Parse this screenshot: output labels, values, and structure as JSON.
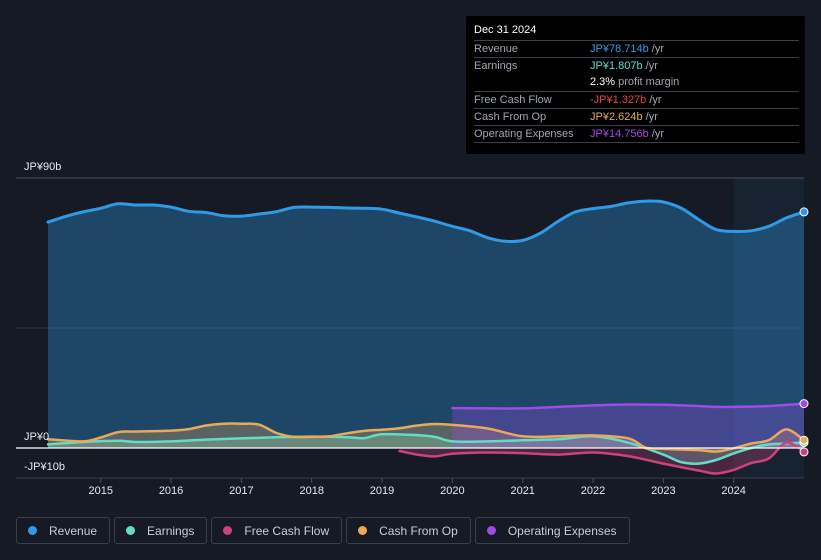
{
  "tooltip": {
    "date": "Dec 31 2024",
    "rows": [
      {
        "label": "Revenue",
        "value": "JP¥78.714b",
        "unit": " /yr",
        "color": "#2f9be6"
      },
      {
        "label": "Earnings",
        "value": "JP¥1.807b",
        "unit": " /yr",
        "color": "#62dcc6"
      },
      {
        "label": "",
        "value": "2.3%",
        "unit": " profit margin",
        "color": "#ffffff"
      },
      {
        "label": "Free Cash Flow",
        "value": "-JP¥1.327b",
        "unit": " /yr",
        "color": "#e8414a"
      },
      {
        "label": "Cash From Op",
        "value": "JP¥2.624b",
        "unit": " /yr",
        "color": "#e8a95a"
      },
      {
        "label": "Operating Expenses",
        "value": "JP¥14.756b",
        "unit": " /yr",
        "color": "#a04ae8"
      }
    ]
  },
  "legend": [
    {
      "label": "Revenue",
      "color": "#2f9be6"
    },
    {
      "label": "Earnings",
      "color": "#62dcc6"
    },
    {
      "label": "Free Cash Flow",
      "color": "#c9447f"
    },
    {
      "label": "Cash From Op",
      "color": "#e8a95a"
    },
    {
      "label": "Operating Expenses",
      "color": "#a04ae8"
    }
  ],
  "chart_data": {
    "type": "area",
    "title": "",
    "xlabel": "",
    "ylabel": "",
    "y_tick_labels": [
      {
        "value": 90,
        "label": "JP¥90b"
      },
      {
        "value": 0,
        "label": "JP¥0"
      },
      {
        "value": -10,
        "label": "-JP¥10b"
      }
    ],
    "ylim": [
      -10,
      90
    ],
    "xlim": [
      2014.25,
      2025.0
    ],
    "x_ticks": [
      2015,
      2016,
      2017,
      2018,
      2019,
      2020,
      2021,
      2022,
      2023,
      2024
    ],
    "x_tick_labels": [
      "2015",
      "2016",
      "2017",
      "2018",
      "2019",
      "2020",
      "2021",
      "2022",
      "2023",
      "2024"
    ],
    "grid": true,
    "highlight_start": 2024.0,
    "units": "JP¥ billions",
    "series": [
      {
        "name": "Revenue",
        "color": "#2f9be6",
        "x": [
          2014.25,
          2014.5,
          2014.75,
          2015.0,
          2015.25,
          2015.5,
          2015.75,
          2016.0,
          2016.25,
          2016.5,
          2016.75,
          2017.0,
          2017.25,
          2017.5,
          2017.75,
          2018.0,
          2018.25,
          2018.5,
          2018.75,
          2019.0,
          2019.25,
          2019.5,
          2019.75,
          2020.0,
          2020.25,
          2020.5,
          2020.75,
          2021.0,
          2021.25,
          2021.5,
          2021.75,
          2022.0,
          2022.25,
          2022.5,
          2022.75,
          2023.0,
          2023.25,
          2023.5,
          2023.75,
          2024.0,
          2024.25,
          2024.5,
          2024.75,
          2025.0
        ],
        "values": [
          75.3,
          77.2,
          78.7,
          79.9,
          81.4,
          81.0,
          81.0,
          80.3,
          78.9,
          78.5,
          77.4,
          77.3,
          78.0,
          78.8,
          80.2,
          80.3,
          80.2,
          80.0,
          79.9,
          79.6,
          78.3,
          77.0,
          75.6,
          73.9,
          72.4,
          70.1,
          68.9,
          69.2,
          71.6,
          75.5,
          78.7,
          79.8,
          80.5,
          81.7,
          82.3,
          82.0,
          80.0,
          76.2,
          72.8,
          72.2,
          72.4,
          73.9,
          76.7,
          78.7
        ]
      },
      {
        "name": "Earnings",
        "color": "#62dcc6",
        "x": [
          2014.25,
          2014.75,
          2015.25,
          2015.5,
          2016.0,
          2016.5,
          2017.0,
          2017.5,
          2018.0,
          2018.5,
          2018.75,
          2019.0,
          2019.5,
          2019.75,
          2020.0,
          2020.5,
          2021.0,
          2021.5,
          2022.0,
          2022.5,
          2023.0,
          2023.25,
          2023.5,
          2023.75,
          2024.0,
          2024.25,
          2024.5,
          2024.75,
          2025.0
        ],
        "values": [
          1.2,
          2.0,
          2.4,
          2.0,
          2.2,
          2.8,
          3.2,
          3.6,
          3.8,
          3.6,
          3.3,
          4.6,
          4.3,
          3.7,
          2.2,
          2.2,
          2.6,
          2.9,
          3.9,
          1.8,
          -2.2,
          -4.7,
          -5.2,
          -4.0,
          -1.8,
          0.0,
          1.2,
          1.5,
          1.8
        ]
      },
      {
        "name": "Free Cash Flow",
        "color": "#c9447f",
        "x": [
          2019.25,
          2019.5,
          2019.75,
          2020.0,
          2020.5,
          2021.0,
          2021.5,
          2022.0,
          2022.5,
          2023.0,
          2023.5,
          2023.75,
          2024.0,
          2024.25,
          2024.5,
          2024.75,
          2025.0
        ],
        "values": [
          -1.0,
          -2.2,
          -2.8,
          -1.9,
          -1.5,
          -1.7,
          -2.2,
          -1.5,
          -2.7,
          -5.2,
          -7.5,
          -8.5,
          -7.3,
          -5.0,
          -3.5,
          1.8,
          -1.3
        ]
      },
      {
        "name": "Cash From Op",
        "color": "#e8a95a",
        "x": [
          2014.25,
          2014.75,
          2015.0,
          2015.25,
          2015.5,
          2016.0,
          2016.25,
          2016.5,
          2016.75,
          2017.0,
          2017.25,
          2017.5,
          2017.75,
          2018.0,
          2018.25,
          2018.5,
          2018.75,
          2019.0,
          2019.25,
          2019.5,
          2019.75,
          2020.0,
          2020.5,
          2021.0,
          2021.5,
          2022.0,
          2022.5,
          2022.75,
          2023.0,
          2023.5,
          2023.75,
          2024.0,
          2024.25,
          2024.5,
          2024.75,
          2025.0
        ],
        "values": [
          2.9,
          2.2,
          3.5,
          5.3,
          5.5,
          5.8,
          6.3,
          7.5,
          8.1,
          8.1,
          7.8,
          5.0,
          3.7,
          3.7,
          3.9,
          4.9,
          5.7,
          6.1,
          6.6,
          7.5,
          8.0,
          7.7,
          6.5,
          3.9,
          3.9,
          4.2,
          3.2,
          0.1,
          -0.3,
          -0.7,
          -1.2,
          -0.1,
          1.5,
          2.6,
          6.2,
          2.6
        ]
      },
      {
        "name": "Operating Expenses",
        "color": "#a04ae8",
        "x": [
          2020.0,
          2020.5,
          2021.0,
          2021.5,
          2022.0,
          2022.5,
          2023.0,
          2023.5,
          2023.75,
          2024.0,
          2024.5,
          2025.0
        ],
        "values": [
          13.3,
          13.2,
          13.2,
          13.7,
          14.2,
          14.5,
          14.4,
          14.0,
          13.7,
          13.7,
          14.0,
          14.8
        ]
      }
    ]
  }
}
